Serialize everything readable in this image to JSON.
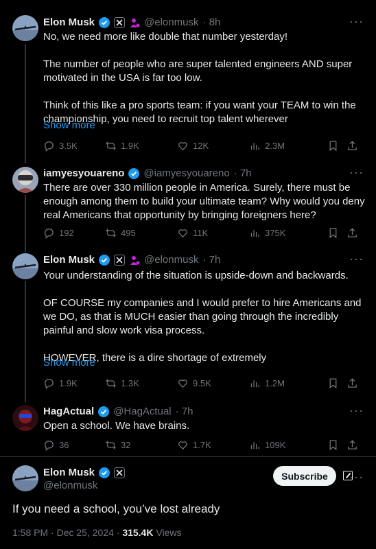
{
  "posts": [
    {
      "name": "Elon Musk",
      "handle": "@elonmusk",
      "time": "· 8h",
      "text": "No, we need more like double that number yesterday!\n\nThe number of people who are super talented engineers AND super motivated in the USA is far too low.\n\nThink of this like a pro sports team: if you want your TEAM to win the championship, you need to recruit top talent wherever",
      "show_more": "Show more",
      "replies": "3.5K",
      "reposts": "1.9K",
      "likes": "12K",
      "views": "2.3M"
    },
    {
      "name": "iamyesyouareno",
      "handle": "@iamyesyouareno",
      "time": "· 7h",
      "text": "There are over 330 million people in America. Surely, there must be enough among them to build your ultimate team? Why would you deny real Americans that opportunity by bringing foreigners here?",
      "replies": "192",
      "reposts": "495",
      "likes": "11K",
      "views": "375K"
    },
    {
      "name": "Elon Musk",
      "handle": "@elonmusk",
      "time": "· 7h",
      "text": "Your understanding of the situation is upside-down and backwards.\n\nOF COURSE my companies and I would prefer to hire Americans and we DO, as that is MUCH easier than going through the incredibly painful and slow work visa process.\n\nHOWEVER, there is a dire shortage of extremely",
      "show_more": "Show more",
      "replies": "1.9K",
      "reposts": "1.3K",
      "likes": "9.5K",
      "views": "1.2M"
    },
    {
      "name": "HagActual",
      "handle": "@HagActual",
      "time": "· 7h",
      "text": "Open a school. We have brains.",
      "replies": "36",
      "reposts": "32",
      "likes": "1.7K",
      "views": "109K"
    }
  ],
  "main": {
    "name": "Elon Musk",
    "handle": "@elonmusk",
    "subscribe_label": "Subscribe",
    "text": "If you need a school, you’ve lost already",
    "date": "1:58 PM · Dec 25, 2024 ·",
    "views_count": "315.4K",
    "views_label": "Views"
  },
  "colors": {
    "background": "#000000",
    "text": "#e7e9ea",
    "muted": "#71767b",
    "link": "#1d9bf0",
    "verified": "#1d9bf0",
    "affiliate": "#c026d3"
  },
  "icons": {
    "reply": "reply-icon",
    "repost": "repost-icon",
    "like": "like-icon",
    "views": "views-icon",
    "bookmark": "bookmark-icon",
    "share": "share-icon"
  }
}
